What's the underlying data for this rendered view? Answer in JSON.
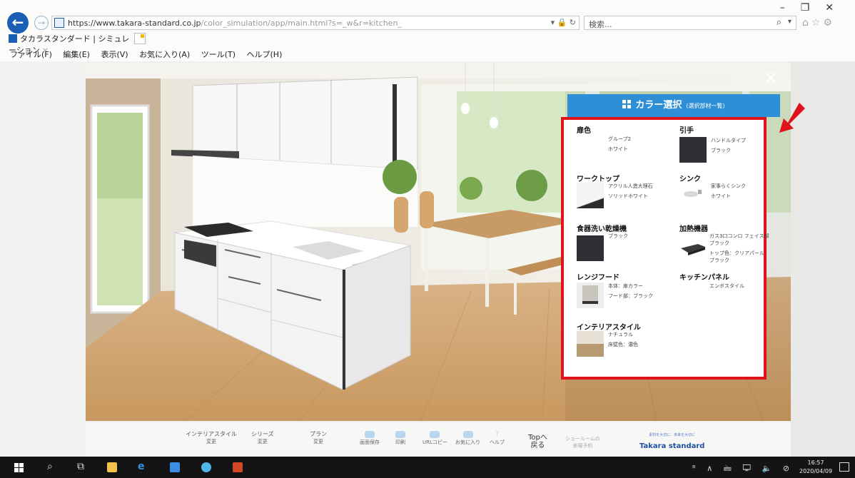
{
  "browser": {
    "url_main": "https://www.takara-standard.co.jp",
    "url_rest": "/color_simulation/app/main.html?s=_w&r=kitchen_",
    "search_placeholder": "検索...",
    "tab_title": "タカラスタンダード | シミュレーション",
    "tab_close": "×",
    "menu": [
      "ファイル(F)",
      "編集(E)",
      "表示(V)",
      "お気に入り(A)",
      "ツール(T)",
      "ヘルプ(H)"
    ]
  },
  "overlay": {
    "close_label": "×"
  },
  "panel": {
    "title": "カラー選択",
    "subtitle": "(選択部材一覧)",
    "options": [
      {
        "title": "扉色",
        "values": [
          "グループ2",
          "ホワイト"
        ],
        "swatch": "#ffffff"
      },
      {
        "title": "引手",
        "values": [
          "ハンドルタイプ",
          "ブラック"
        ],
        "swatch": "#2e3035"
      },
      {
        "title": "ワークトップ",
        "values": [
          "アクリル人造大理石",
          "ソリッドホワイト"
        ],
        "swatch": "#f4f4f2"
      },
      {
        "title": "シンク",
        "values": [
          "家事らくシンク",
          "ホワイト"
        ],
        "swatch": "#e6e6e6"
      },
      {
        "title": "食器洗い乾燥機",
        "values": [
          "ブラック"
        ],
        "swatch": "#2e3035"
      },
      {
        "title": "加熱機器",
        "values": [
          "ガス3口コンロ フェイス部",
          "ブラック",
          "トップ色：クリアパールブラック"
        ],
        "swatch": "#3a3a3a"
      },
      {
        "title": "レンジフード",
        "values": [
          "本体：扉カラー",
          "フード部：ブラック"
        ],
        "swatch": "#c9c4bd"
      },
      {
        "title": "キッチンパネル",
        "values": [
          "エンボスタイル"
        ],
        "swatch": "#ffffff"
      },
      {
        "title": "インテリアスタイル",
        "values": [
          "ナチュラル",
          "床壁色：濃色"
        ],
        "swatch": "#b89a72"
      }
    ]
  },
  "toolbar": {
    "items": [
      {
        "label": "インテリアスタイル",
        "sub": "変更"
      },
      {
        "label": "シリーズ",
        "sub": "変更"
      },
      {
        "label": "プラン",
        "sub": "変更"
      },
      {
        "label": "画面保存",
        "sub": ""
      },
      {
        "label": "印刷",
        "sub": ""
      },
      {
        "label": "URLコピー",
        "sub": ""
      },
      {
        "label": "お気に入り",
        "sub": ""
      },
      {
        "label": "ヘルプ",
        "sub": ""
      }
    ],
    "top_label": "Topへ",
    "top_sub": "戻る",
    "showroom": "ショールームの",
    "showroom_sub": "来場予約",
    "brand_tagline": "素材を大切に、未来を大切に",
    "brand_name": "Takara standard"
  },
  "taskbar": {
    "time": "16:57",
    "date": "2020/04/09",
    "tray": "ᴿ ∧ 🖮 🖵 🔈 ⊘"
  },
  "colors": {
    "accent": "#2e8fd6",
    "highlight": "#e0121b",
    "arrow": "#e0121b"
  }
}
